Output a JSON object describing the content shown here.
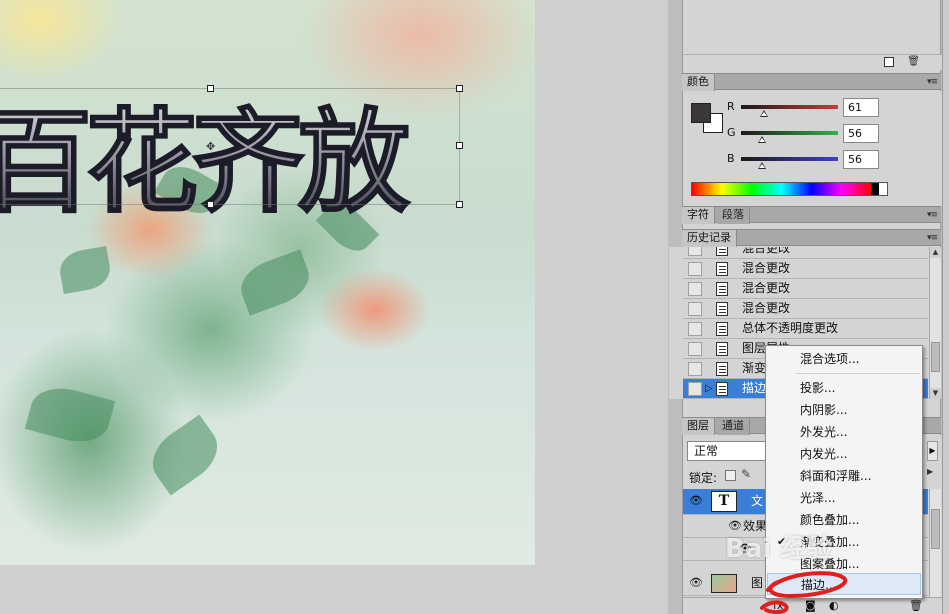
{
  "canvas": {
    "headline": "百花齐放"
  },
  "color_panel": {
    "tab": "颜色",
    "channels": [
      {
        "label": "R",
        "value": "61",
        "color": "#c83a3a",
        "level": 0.24
      },
      {
        "label": "G",
        "value": "56",
        "color": "#38b048",
        "level": 0.22
      },
      {
        "label": "B",
        "value": "56",
        "color": "#4040c8",
        "level": 0.22
      }
    ],
    "foreground": "#3d3838",
    "background": "#ffffff"
  },
  "char_panel": {
    "tabs": [
      "字符",
      "段落"
    ]
  },
  "history_panel": {
    "tab": "历史记录",
    "items": [
      {
        "label": "混合更改",
        "selected": false
      },
      {
        "label": "混合更改",
        "selected": false
      },
      {
        "label": "混合更改",
        "selected": false
      },
      {
        "label": "混合更改",
        "selected": false
      },
      {
        "label": "总体不透明度更改",
        "selected": false
      },
      {
        "label": "图层属性",
        "selected": false
      },
      {
        "label": "渐变",
        "selected": false
      },
      {
        "label": "描边",
        "selected": true
      }
    ]
  },
  "layers_panel": {
    "tabs": [
      "图层",
      "通道"
    ],
    "blend_mode": "正常",
    "lock_label": "锁定:",
    "layers": [
      {
        "name": "文",
        "type_glyph": "T",
        "visible": true,
        "selected": true
      },
      {
        "name": "效果",
        "sub": true
      },
      {
        "name": "图",
        "visible": true
      }
    ]
  },
  "context_menu": {
    "items": [
      {
        "label": "混合选项...",
        "checked": false,
        "highlight": false
      },
      {
        "label": "投影...",
        "checked": false,
        "highlight": false
      },
      {
        "label": "内阴影...",
        "checked": false,
        "highlight": false
      },
      {
        "label": "外发光...",
        "checked": false,
        "highlight": false
      },
      {
        "label": "内发光...",
        "checked": false,
        "highlight": false
      },
      {
        "label": "斜面和浮雕...",
        "checked": false,
        "highlight": false
      },
      {
        "label": "光泽...",
        "checked": false,
        "highlight": false
      },
      {
        "label": "颜色叠加...",
        "checked": false,
        "highlight": false
      },
      {
        "label": "渐变叠加...",
        "checked": true,
        "highlight": false
      },
      {
        "label": "图案叠加...",
        "checked": false,
        "highlight": false
      },
      {
        "label": "描边...",
        "checked": false,
        "highlight": true
      }
    ]
  },
  "watermark": "Bai 经验",
  "annotation_color": "#e02020"
}
